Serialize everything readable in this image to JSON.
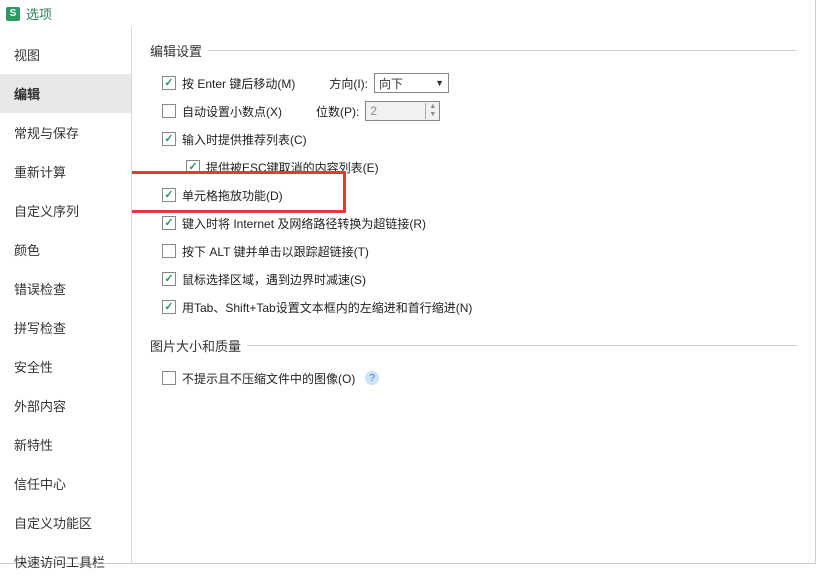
{
  "title": "选项",
  "sidebar": {
    "items": [
      {
        "label": "视图"
      },
      {
        "label": "编辑"
      },
      {
        "label": "常规与保存"
      },
      {
        "label": "重新计算"
      },
      {
        "label": "自定义序列"
      },
      {
        "label": "颜色"
      },
      {
        "label": "错误检查"
      },
      {
        "label": "拼写检查"
      },
      {
        "label": "安全性"
      },
      {
        "label": "外部内容"
      },
      {
        "label": "新特性"
      },
      {
        "label": "信任中心"
      },
      {
        "label": "自定义功能区"
      },
      {
        "label": "快速访问工具栏"
      }
    ],
    "active_index": 1
  },
  "groups": {
    "edit": {
      "header": "编辑设置",
      "enter_move": {
        "label": "按 Enter 键后移动(M)",
        "checked": true
      },
      "direction_label": "方向(I):",
      "direction_value": "向下",
      "auto_decimal": {
        "label": "自动设置小数点(X)",
        "checked": false
      },
      "digits_label": "位数(P):",
      "digits_value": "2",
      "suggest_list": {
        "label": "输入时提供推荐列表(C)",
        "checked": true
      },
      "esc_list": {
        "label": "提供被ESC键取消的内容列表(E)",
        "checked": true
      },
      "drag_drop": {
        "label": "单元格拖放功能(D)",
        "checked": true
      },
      "hyperlink": {
        "label": "键入时将 Internet 及网络路径转换为超链接(R)",
        "checked": true
      },
      "alt_click": {
        "label": "按下 ALT 键并单击以跟踪超链接(T)",
        "checked": false
      },
      "mouse_slow": {
        "label": "鼠标选择区域，遇到边界时减速(S)",
        "checked": true
      },
      "tab_indent": {
        "label": "用Tab、Shift+Tab设置文本框内的左缩进和首行缩进(N)",
        "checked": true
      }
    },
    "image": {
      "header": "图片大小和质量",
      "no_compress": {
        "label": "不提示且不压缩文件中的图像(O)",
        "checked": false
      }
    }
  }
}
